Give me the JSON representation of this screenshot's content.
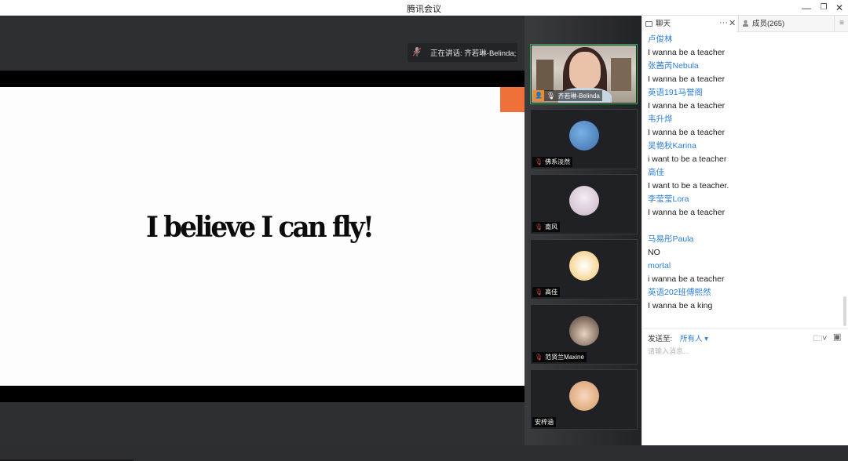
{
  "window": {
    "title": "腾讯会议",
    "minimize": "—",
    "restore": "❐",
    "close": "✕"
  },
  "stage": {
    "speaking_label": "正在讲话: 齐若琳-Belinda;",
    "slide_text": "I believe I can fly!",
    "accent_color": "#f0703a"
  },
  "participants": [
    {
      "name": "齐若琳-Belinda",
      "avatar": "video",
      "avatar_color": "#d8d0c5"
    },
    {
      "name": "佛系淡然",
      "avatar": "group-photo",
      "avatar_color": "#6fa0d8"
    },
    {
      "name": "南风",
      "avatar": "portrait",
      "avatar_color": "#d9c8d6"
    },
    {
      "name": "高佳",
      "avatar": "cartoon",
      "avatar_color": "#f2e9dc"
    },
    {
      "name": "范贤兰Maxine",
      "avatar": "couple",
      "avatar_color": "#8a6a4e"
    },
    {
      "name": "安梓涵",
      "avatar": "child",
      "avatar_color": "#e8b184"
    }
  ],
  "chat": {
    "tab_chat": "聊天",
    "tab_more": "···",
    "tab_close": "✕",
    "tab_members": "成员(265)",
    "tab_menu": "≡",
    "messages": [
      {
        "sender": "卢俊林",
        "text": "I wanna be a teacher"
      },
      {
        "sender": "张茜芮Nebula",
        "text": "I wanna be a teacher"
      },
      {
        "sender": "英语191马誉阁",
        "text": "I wanna be a teacher"
      },
      {
        "sender": "韦升烨",
        "text": "I wanna be a teacher"
      },
      {
        "sender": "吴艳秋Karina",
        "text": "i want  to be a teacher"
      },
      {
        "sender": "高佳",
        "text": "I want to be a teacher."
      },
      {
        "sender": "李莹莹Lora",
        "text": "I wanna be a teacher"
      },
      {
        "sender": "",
        "text": ""
      },
      {
        "sender": "马易彤Paula",
        "text": "NO"
      },
      {
        "sender": "mortal",
        "text": "i wanna be a teacher"
      },
      {
        "sender": "英语202班傅熙然",
        "text": "I wanna be a king"
      }
    ],
    "send_to_label": "发送至:",
    "send_to_value": "所有人 ▾",
    "input_placeholder": "请输入消息...",
    "tool_file": "🗀˅",
    "tool_screenshot": "▣"
  }
}
